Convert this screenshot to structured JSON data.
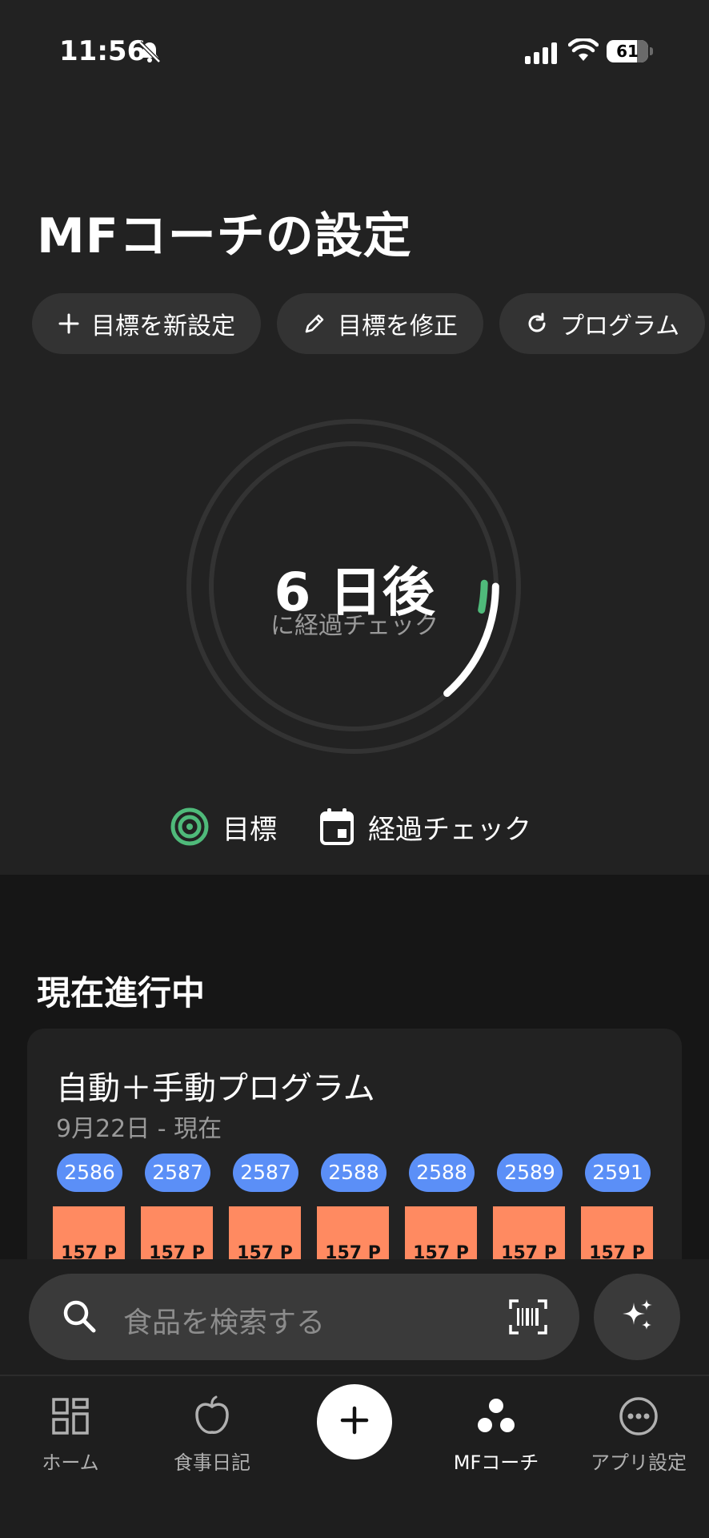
{
  "status_bar": {
    "time": "11:56",
    "battery": "61"
  },
  "header": {
    "title": "MFコーチの設定"
  },
  "actions": [
    {
      "label": "目標を新設定",
      "icon": "plus-icon"
    },
    {
      "label": "目標を修正",
      "icon": "pencil-icon"
    },
    {
      "label": "プログラム",
      "icon": "refresh-icon"
    }
  ],
  "progress_ring": {
    "big_text": "6 日後",
    "sub_text": "に経過チェック"
  },
  "legend": {
    "goal_label": "目標",
    "checkin_label": "経過チェック"
  },
  "current": {
    "section_title": "現在進行中",
    "program_title": "自動＋手動プログラム",
    "date_range": "9月22日 - 現在",
    "days": [
      {
        "value": "2586",
        "protein": "157 P"
      },
      {
        "value": "2587",
        "protein": "157 P"
      },
      {
        "value": "2587",
        "protein": "157 P"
      },
      {
        "value": "2588",
        "protein": "157 P"
      },
      {
        "value": "2588",
        "protein": "157 P"
      },
      {
        "value": "2589",
        "protein": "157 P"
      },
      {
        "value": "2591",
        "protein": "157 P"
      }
    ]
  },
  "search": {
    "placeholder": "食品を検索する"
  },
  "tabs": [
    {
      "label": "ホーム",
      "icon": "grid-icon"
    },
    {
      "label": "食事日記",
      "icon": "apple-icon"
    },
    {
      "label": "MFコーチ",
      "icon": "dots-cluster-icon"
    },
    {
      "label": "アプリ設定",
      "icon": "more-icon"
    }
  ],
  "colors": {
    "accent_green": "#4fba7a",
    "pill_blue": "#5b8ff7",
    "protein_orange": "#ff8a61"
  }
}
